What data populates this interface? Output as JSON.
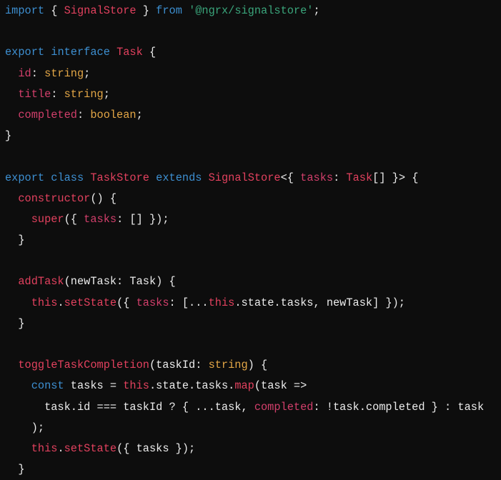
{
  "colors": {
    "background": "#0d0d0d",
    "keyword": "#3d8fd1",
    "class": "#e2415e",
    "property": "#d23f6b",
    "type": "#e3a646",
    "string": "#3aa57b",
    "plain": "#ececec"
  },
  "lines": [
    [
      [
        "import",
        "kw"
      ],
      [
        " { ",
        "pl"
      ],
      [
        "SignalStore",
        "cls"
      ],
      [
        " } ",
        "pl"
      ],
      [
        "from",
        "kw"
      ],
      [
        " ",
        "pl"
      ],
      [
        "'@ngrx/signalstore'",
        "str"
      ],
      [
        ";",
        "pl"
      ]
    ],
    [],
    [
      [
        "export",
        "kw"
      ],
      [
        " ",
        "pl"
      ],
      [
        "interface",
        "kw"
      ],
      [
        " ",
        "pl"
      ],
      [
        "Task",
        "cls"
      ],
      [
        " {",
        "pl"
      ]
    ],
    [
      [
        "  ",
        "pl"
      ],
      [
        "id",
        "prop"
      ],
      [
        ": ",
        "pl"
      ],
      [
        "string",
        "type"
      ],
      [
        ";",
        "pl"
      ]
    ],
    [
      [
        "  ",
        "pl"
      ],
      [
        "title",
        "prop"
      ],
      [
        ": ",
        "pl"
      ],
      [
        "string",
        "type"
      ],
      [
        ";",
        "pl"
      ]
    ],
    [
      [
        "  ",
        "pl"
      ],
      [
        "completed",
        "prop"
      ],
      [
        ": ",
        "pl"
      ],
      [
        "boolean",
        "type"
      ],
      [
        ";",
        "pl"
      ]
    ],
    [
      [
        "}",
        "pl"
      ]
    ],
    [],
    [
      [
        "export",
        "kw"
      ],
      [
        " ",
        "pl"
      ],
      [
        "class",
        "kw"
      ],
      [
        " ",
        "pl"
      ],
      [
        "TaskStore",
        "cls"
      ],
      [
        " ",
        "pl"
      ],
      [
        "extends",
        "kw"
      ],
      [
        " ",
        "pl"
      ],
      [
        "SignalStore",
        "cls"
      ],
      [
        "<{ ",
        "pl"
      ],
      [
        "tasks",
        "prop"
      ],
      [
        ": ",
        "pl"
      ],
      [
        "Task",
        "cls"
      ],
      [
        "[] }> {",
        "pl"
      ]
    ],
    [
      [
        "  ",
        "pl"
      ],
      [
        "constructor",
        "cls"
      ],
      [
        "() {",
        "pl"
      ]
    ],
    [
      [
        "    ",
        "pl"
      ],
      [
        "super",
        "cls"
      ],
      [
        "({ ",
        "pl"
      ],
      [
        "tasks",
        "prop"
      ],
      [
        ": [] });",
        "pl"
      ]
    ],
    [
      [
        "  }",
        "pl"
      ]
    ],
    [],
    [
      [
        "  ",
        "pl"
      ],
      [
        "addTask",
        "cls"
      ],
      [
        "(newTask: Task) {",
        "pl"
      ]
    ],
    [
      [
        "    ",
        "pl"
      ],
      [
        "this",
        "cls"
      ],
      [
        ".",
        "pl"
      ],
      [
        "setState",
        "cls"
      ],
      [
        "({ ",
        "pl"
      ],
      [
        "tasks",
        "prop"
      ],
      [
        ": [...",
        "pl"
      ],
      [
        "this",
        "cls"
      ],
      [
        ".state.tasks, newTask] });",
        "pl"
      ]
    ],
    [
      [
        "  }",
        "pl"
      ]
    ],
    [],
    [
      [
        "  ",
        "pl"
      ],
      [
        "toggleTaskCompletion",
        "cls"
      ],
      [
        "(taskId: ",
        "pl"
      ],
      [
        "string",
        "type"
      ],
      [
        ") {",
        "pl"
      ]
    ],
    [
      [
        "    ",
        "pl"
      ],
      [
        "const",
        "kw"
      ],
      [
        " tasks = ",
        "pl"
      ],
      [
        "this",
        "cls"
      ],
      [
        ".state.tasks.",
        "pl"
      ],
      [
        "map",
        "cls"
      ],
      [
        "(task =>",
        "pl"
      ]
    ],
    [
      [
        "      task.id === taskId ? { ...task, ",
        "pl"
      ],
      [
        "completed",
        "prop"
      ],
      [
        ": !task.completed } : task",
        "pl"
      ]
    ],
    [
      [
        "    );",
        "pl"
      ]
    ],
    [
      [
        "    ",
        "pl"
      ],
      [
        "this",
        "cls"
      ],
      [
        ".",
        "pl"
      ],
      [
        "setState",
        "cls"
      ],
      [
        "({ tasks });",
        "pl"
      ]
    ],
    [
      [
        "  }",
        "pl"
      ]
    ]
  ]
}
